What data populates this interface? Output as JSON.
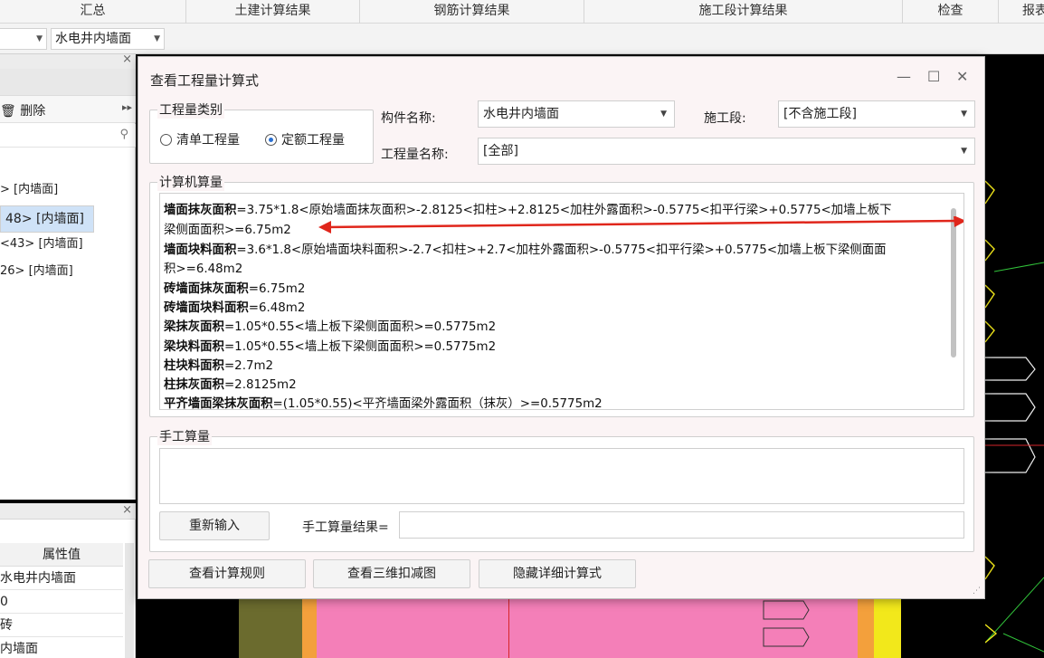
{
  "top_tabs": [
    "汇总",
    "土建计算结果",
    "钢筋计算结果",
    "施工段计算结果",
    "检查",
    "报表"
  ],
  "toolbar": {
    "component_combo": "水电井内墙面"
  },
  "left_panel": {
    "delete_label": "删除",
    "items": [
      "> [内墙面]",
      "48> [内墙面]",
      "<43> [内墙面]",
      "26> [内墙面]"
    ]
  },
  "prop_panel": {
    "header": "属性值",
    "cells": [
      "水电井内墙面",
      "0",
      "砖",
      "内墙面"
    ]
  },
  "dialog": {
    "title": "查看工程量计算式",
    "qty_type": {
      "legend": "工程量类别",
      "options": [
        "清单工程量",
        "定额工程量"
      ],
      "selected": "定额工程量"
    },
    "component_label": "构件名称:",
    "component_value": "水电井内墙面",
    "stage_label": "施工段:",
    "stage_value": "[不含施工段]",
    "qty_name_label": "工程量名称:",
    "qty_name_value": "[全部]",
    "calc_legend": "计算机算量",
    "calc_lines": [
      {
        "name": "墙面抹灰面积",
        "formula": "=3.75*1.8<原始墙面抹灰面积>-2.8125<扣柱>+2.8125<加柱外露面积>-0.5775<扣平行梁>+0.5775<加墙上板下"
      },
      {
        "name": "",
        "formula": "梁侧面面积>=6.75m2"
      },
      {
        "name": "墙面块料面积",
        "formula": "=3.6*1.8<原始墙面块料面积>-2.7<扣柱>+2.7<加柱外露面积>-0.5775<扣平行梁>+0.5775<加墙上板下梁侧面面"
      },
      {
        "name": "",
        "formula": "积>=6.48m2"
      },
      {
        "name": "砖墙面抹灰面积",
        "formula": "=6.75m2"
      },
      {
        "name": "砖墙面块料面积",
        "formula": "=6.48m2"
      },
      {
        "name": "梁抹灰面积",
        "formula": "=1.05*0.55<墙上板下梁侧面面积>=0.5775m2"
      },
      {
        "name": "梁块料面积",
        "formula": "=1.05*0.55<墙上板下梁侧面面积>=0.5775m2"
      },
      {
        "name": "柱块料面积",
        "formula": "=2.7m2"
      },
      {
        "name": "柱抹灰面积",
        "formula": "=2.8125m2"
      },
      {
        "name": "平齐墙面梁抹灰面积",
        "formula": "=(1.05*0.55)<平齐墙面梁外露面积（抹灰）>=0.5775m2"
      }
    ],
    "manual_legend": "手工算量",
    "reinput_button": "重新输入",
    "manual_result_label": "手工算量结果=",
    "manual_result_value": "",
    "buttons": {
      "view_rules": "查看计算规则",
      "view_3d": "查看三维扣减图",
      "hide_detail": "隐藏详细计算式"
    }
  },
  "colors": {
    "annotation_arrow": "#e0261b",
    "selection": "#cfe2f7",
    "radio_accent": "#2a6fd1",
    "cad_pink": "#f47fb8",
    "cad_yellow": "#f2e81b",
    "cad_orange": "#f3a03c"
  }
}
